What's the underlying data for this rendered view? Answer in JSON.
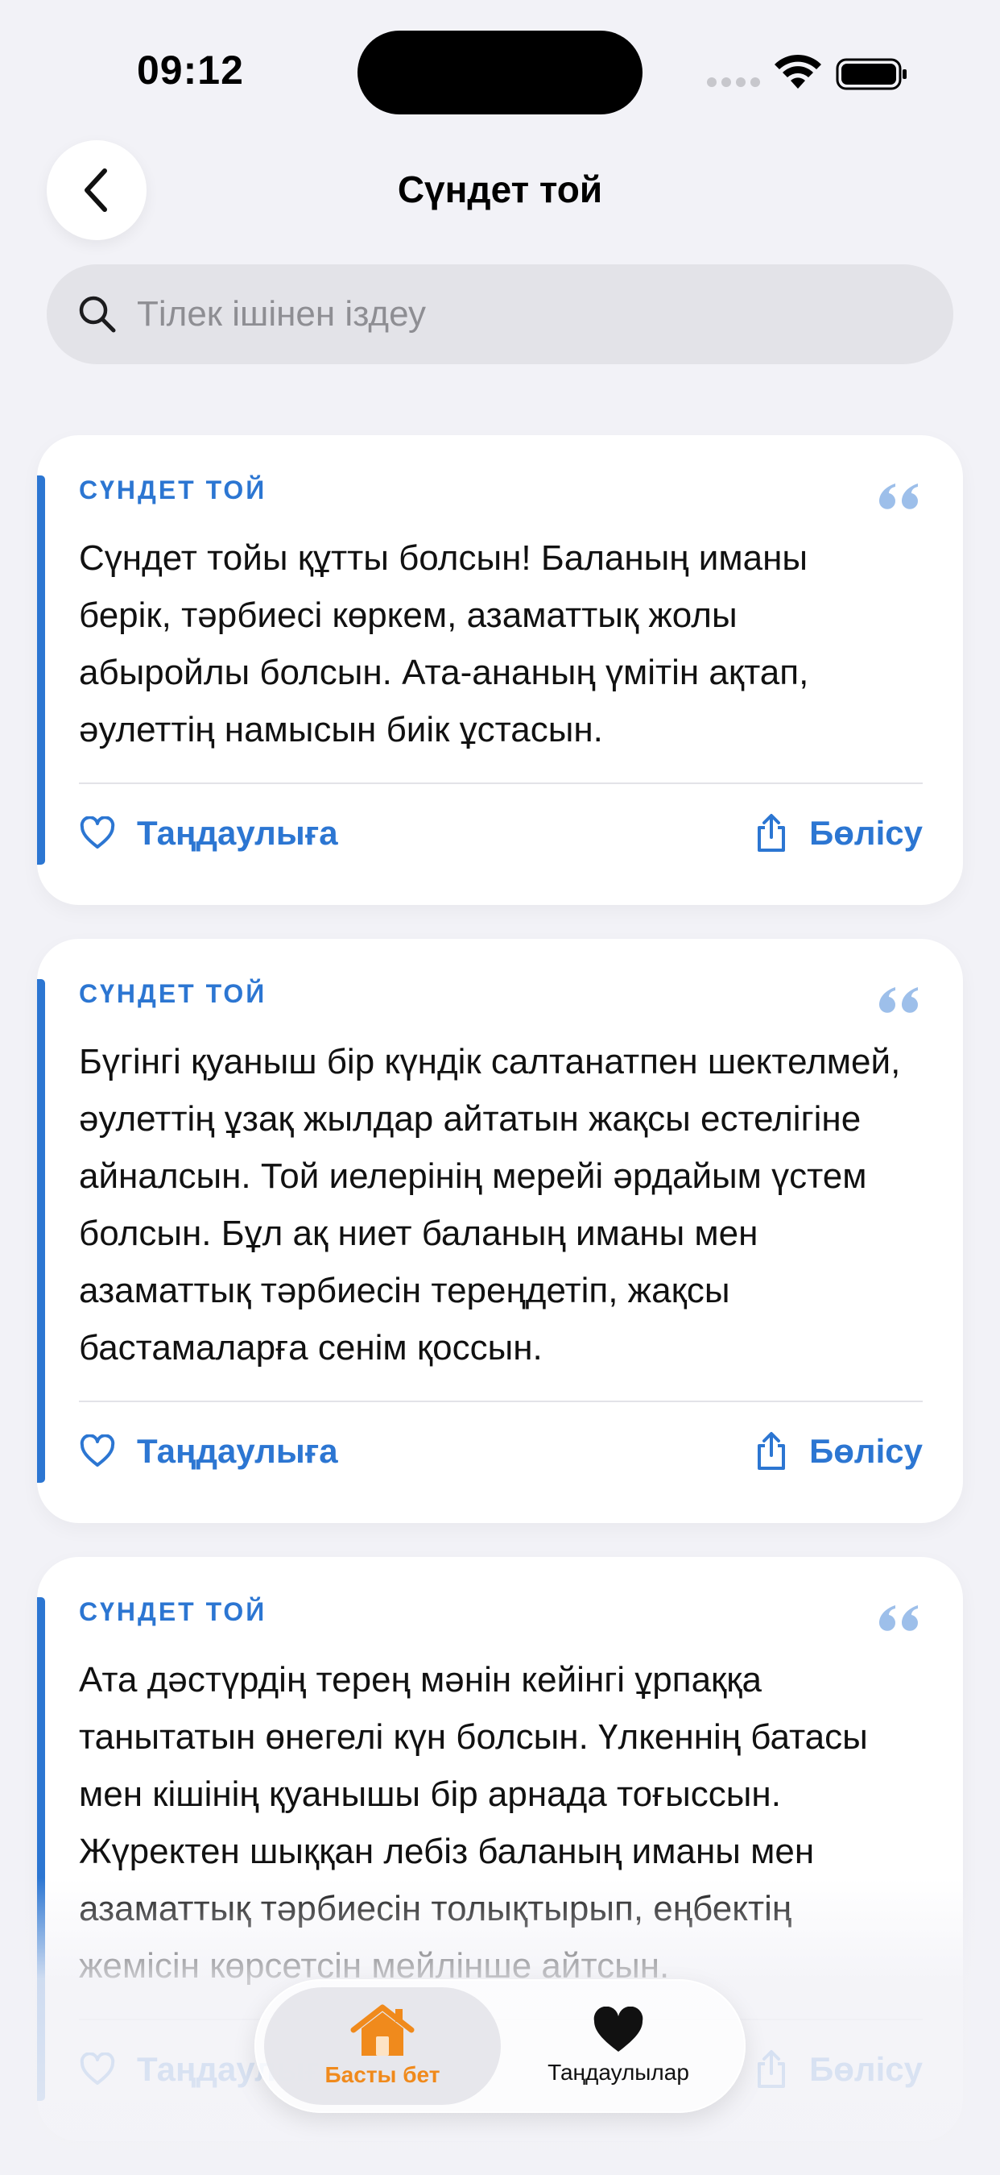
{
  "status_bar": {
    "time": "09:12"
  },
  "header": {
    "title": "Сүндет той"
  },
  "search": {
    "placeholder": "Тілек ішінен іздеу"
  },
  "cards": [
    {
      "category": "СҮНДЕТ ТОЙ",
      "text": "Сүндет тойы құтты болсын! Баланың иманы берік, тәрбиесі көркем, азаматтық жолы абыройлы болсын. Ата-ананың үмітін ақтап, әулеттің намысын биік ұстасын.",
      "favorite_label": "Таңдаулыға",
      "share_label": "Бөлісу"
    },
    {
      "category": "СҮНДЕТ ТОЙ",
      "text": "Бүгінгі қуаныш бір күндік салтанатпен шектелмей, әулеттің ұзақ жылдар айтатын жақсы естелігіне айналсын. Той иелерінің мерейі әрдайым үстем болсын. Бұл ақ ниет баланың иманы мен азаматтық тәрбиесін тереңдетіп, жақсы бастамаларға сенім қоссын.",
      "favorite_label": "Таңдаулыға",
      "share_label": "Бөлісу"
    },
    {
      "category": "СҮНДЕТ ТОЙ",
      "text": "Ата дәстүрдің терең мәнін кейінгі ұрпаққа танытатын өнегелі күн болсын. Үлкеннің батасы мен кішінің қуанышы бір арнада тоғыссын. Жүректен шыққан лебіз баланың иманы мен азаматтық тәрбиесін толықтырып, еңбектің жемісін көрсетсін мейлінше айтсын.",
      "favorite_label": "Таңдаулыға",
      "share_label": "Бөлісу"
    }
  ],
  "tab_bar": {
    "home_label": "Басты бет",
    "favorites_label": "Таңдаулылар"
  },
  "colors": {
    "accent": "#2c76d2",
    "home_tab": "#f08a1c",
    "background": "#f2f2f7"
  },
  "icons": [
    "back-chevron-icon",
    "search-icon",
    "quote-icon",
    "heart-outline-icon",
    "share-icon",
    "home-icon",
    "heart-filled-icon"
  ]
}
